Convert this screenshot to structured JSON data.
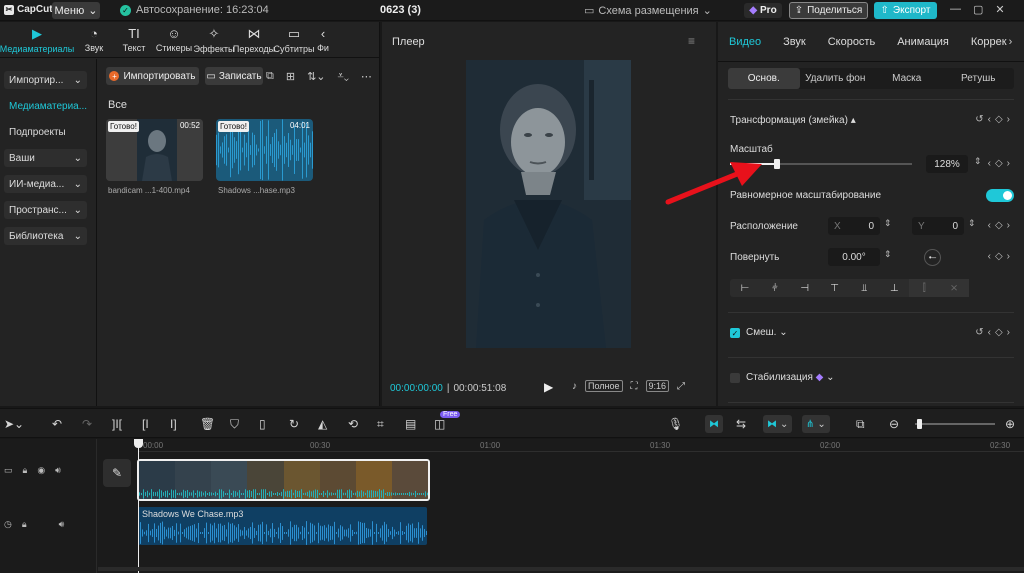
{
  "titlebar": {
    "logo_text": "CapCut",
    "menu_label": "Меню",
    "autosave": "Автосохранение: 16:23:04",
    "project_title": "0623 (3)",
    "layout_label": "Схема размещения",
    "pro_label": "Pro",
    "share_label": "Поделиться",
    "export_label": "Экспорт"
  },
  "media_tabs": [
    {
      "label": "Медиаматериалы",
      "icon": "media-icon",
      "glyph": "▶"
    },
    {
      "label": "Звук",
      "icon": "audio-icon",
      "glyph": "◔"
    },
    {
      "label": "Текст",
      "icon": "text-icon",
      "glyph": "TI"
    },
    {
      "label": "Стикеры",
      "icon": "sticker-icon",
      "glyph": "☺"
    },
    {
      "label": "Эффекты",
      "icon": "effects-icon",
      "glyph": "✧"
    },
    {
      "label": "Переходы",
      "icon": "transitions-icon",
      "glyph": "⋈"
    },
    {
      "label": "Субтитры",
      "icon": "subtitles-icon",
      "glyph": "▭"
    },
    {
      "label": "Фи",
      "icon": "filters-icon",
      "glyph": "‹"
    }
  ],
  "side_nav": [
    {
      "label": "Импортир...",
      "has_chevron": true
    },
    {
      "label": "Медиаматериа...",
      "has_chevron": false
    },
    {
      "label": "Подпроекты",
      "has_chevron": false
    },
    {
      "label": "Ваши",
      "has_chevron": true
    },
    {
      "label": "ИИ-медиа...",
      "has_chevron": true
    },
    {
      "label": "Пространс...",
      "has_chevron": true
    },
    {
      "label": "Библиотека",
      "has_chevron": true
    }
  ],
  "media": {
    "import_label": "Импортировать",
    "record_label": "Записать",
    "all_label": "Все",
    "items": [
      {
        "badge": "Готово!",
        "duration": "00:52",
        "name": "bandicam ...1-400.mp4",
        "kind": "video"
      },
      {
        "badge": "Готово!",
        "duration": "04:01",
        "name": "Shadows ...hase.mp3",
        "kind": "audio"
      }
    ]
  },
  "player": {
    "title": "Плеер",
    "current_time": "00:00:00:00",
    "total_time": "00:00:51:08",
    "full_label": "Полное",
    "ratio_label": "9:16"
  },
  "inspector": {
    "tabs": [
      "Видео",
      "Звук",
      "Скорость",
      "Анимация",
      "Коррек"
    ],
    "subtabs": [
      "Основ.",
      "Удалить фон",
      "Маска",
      "Ретушь"
    ],
    "transform_label": "Трансформация (змейка)",
    "scale_label": "Масштаб",
    "scale_value": "128%",
    "scale_fraction": 0.26,
    "uniform_label": "Равномерное масштабирование",
    "position_label": "Расположение",
    "x_label": "X",
    "x_value": "0",
    "y_label": "Y",
    "y_value": "0",
    "rotate_label": "Повернуть",
    "rotate_value": "0.00°",
    "blend_label": "Смеш.",
    "stabilize_label": "Стабилизация"
  },
  "toolbar": {
    "free_label": "Free"
  },
  "timeline": {
    "ticks": [
      "00:00",
      "00:30",
      "01:00",
      "01:30",
      "02:00",
      "02:30"
    ],
    "audio_clip_label": "Shadows We Chase.mp3"
  },
  "colors": {
    "accent": "#1fc8d8",
    "export": "#1fb8c9",
    "arrow": "#e8111b"
  }
}
